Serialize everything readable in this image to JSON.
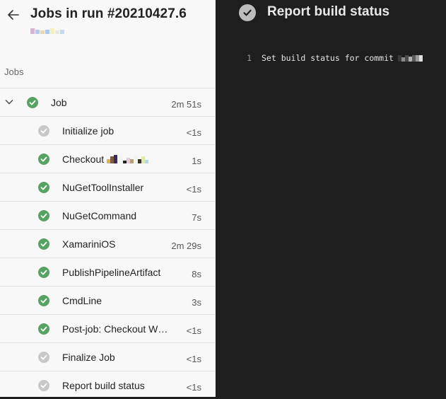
{
  "header": {
    "title": "Jobs in run #20210427.6"
  },
  "sidebar": {
    "section_label": "Jobs",
    "job": {
      "label": "Job",
      "duration": "2m 51s",
      "status": "succeeded"
    },
    "steps": [
      {
        "label": "Initialize job",
        "duration": "<1s",
        "status": "skipped"
      },
      {
        "label": "Checkout",
        "duration": "1s",
        "status": "succeeded"
      },
      {
        "label": "NuGetToolInstaller",
        "duration": "<1s",
        "status": "succeeded"
      },
      {
        "label": "NuGetCommand",
        "duration": "7s",
        "status": "succeeded"
      },
      {
        "label": "XamariniOS",
        "duration": "2m 29s",
        "status": "succeeded"
      },
      {
        "label": "PublishPipelineArtifact",
        "duration": "8s",
        "status": "succeeded"
      },
      {
        "label": "CmdLine",
        "duration": "3s",
        "status": "succeeded"
      },
      {
        "label": "Post-job: Checkout W…",
        "duration": "<1s",
        "status": "succeeded"
      },
      {
        "label": "Finalize Job",
        "duration": "<1s",
        "status": "skipped"
      },
      {
        "label": "Report build status",
        "duration": "<1s",
        "status": "skipped"
      }
    ]
  },
  "detail": {
    "title": "Report build status",
    "log": [
      {
        "line": "1",
        "text": "Set build status for commit"
      }
    ]
  },
  "colors": {
    "succeeded": "#55a362",
    "skipped": "#c8c8c8",
    "log_background": "#1e1e1e"
  }
}
